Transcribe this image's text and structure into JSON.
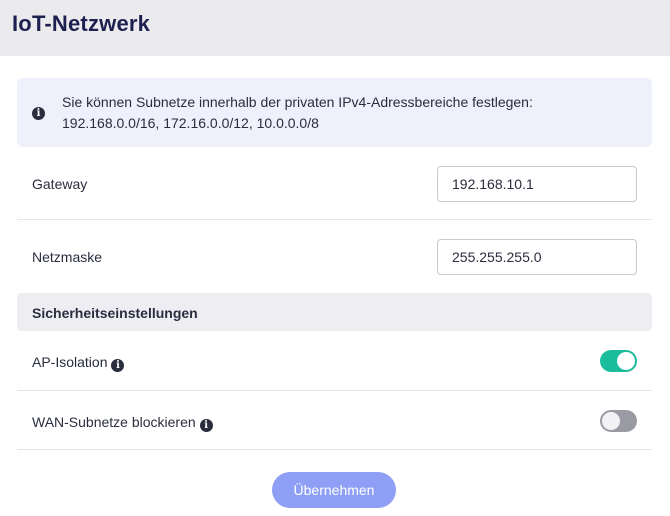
{
  "header": {
    "title": "IoT-Netzwerk"
  },
  "info": {
    "icon": "info-icon",
    "line1": "Sie können Subnetze innerhalb der privaten IPv4-Adressbereiche festlegen:",
    "line2": "192.168.0.0/16, 172.16.0.0/12, 10.0.0.0/8"
  },
  "gateway": {
    "label": "Gateway",
    "value": "192.168.10.1"
  },
  "netmask": {
    "label": "Netzmaske",
    "value": "255.255.255.0"
  },
  "security": {
    "title": "Sicherheitseinstellungen",
    "ap_isolation": {
      "label": "AP-Isolation",
      "enabled": true
    },
    "wan_block": {
      "label": "WAN-Subnetze blockieren",
      "enabled": false
    }
  },
  "actions": {
    "apply_label": "Übernehmen"
  },
  "colors": {
    "accent_toggle_on": "#1abc9c",
    "toggle_off": "#9a9aa2",
    "primary_button": "#8e9ff5",
    "header_text": "#1e2150"
  }
}
